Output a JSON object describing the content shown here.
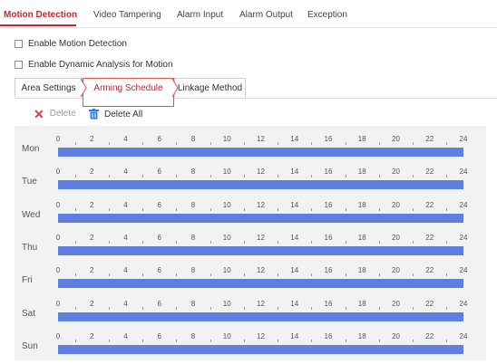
{
  "tabs": [
    {
      "label": "Motion Detection",
      "active": true
    },
    {
      "label": "Video Tampering",
      "active": false
    },
    {
      "label": "Alarm Input",
      "active": false
    },
    {
      "label": "Alarm Output",
      "active": false
    },
    {
      "label": "Exception",
      "active": false
    }
  ],
  "options": {
    "enable_motion_detection": {
      "label": "Enable Motion Detection",
      "checked": false
    },
    "enable_dynamic_analysis": {
      "label": "Enable Dynamic Analysis for Motion",
      "checked": false
    }
  },
  "subtabs": [
    {
      "label": "Area Settings",
      "active": false
    },
    {
      "label": "Arming Schedule",
      "active": true
    },
    {
      "label": "Linkage Method",
      "active": false
    }
  ],
  "actions": {
    "delete_label": "Delete",
    "delete_icon": "x-icon",
    "delete_all_label": "Delete All",
    "delete_all_icon": "trash-icon"
  },
  "schedule": {
    "hour_labels": [
      "0",
      "2",
      "4",
      "6",
      "8",
      "10",
      "12",
      "14",
      "16",
      "18",
      "20",
      "22",
      "24"
    ],
    "days": [
      {
        "label": "Mon",
        "segments": [
          [
            0,
            24
          ]
        ]
      },
      {
        "label": "Tue",
        "segments": [
          [
            0,
            24
          ]
        ]
      },
      {
        "label": "Wed",
        "segments": [
          [
            0,
            24
          ]
        ]
      },
      {
        "label": "Thu",
        "segments": [
          [
            0,
            24
          ]
        ]
      },
      {
        "label": "Fri",
        "segments": [
          [
            0,
            24
          ]
        ]
      },
      {
        "label": "Sat",
        "segments": [
          [
            0,
            24
          ]
        ]
      },
      {
        "label": "Sun",
        "segments": [
          [
            0,
            24
          ]
        ]
      }
    ]
  },
  "colors": {
    "accent": "#c8262f",
    "schedule_bar": "#5e7fe0",
    "schedule_bg": "#f2f2f2"
  }
}
